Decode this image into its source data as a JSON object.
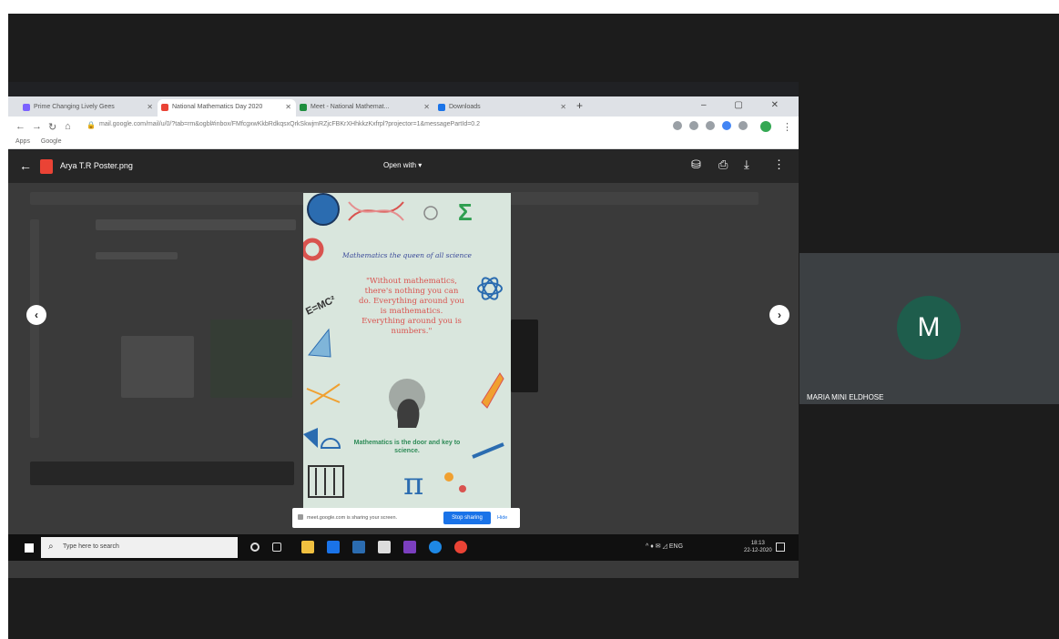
{
  "browser": {
    "tabs": [
      {
        "label": "Prime Changing Lively Gees",
        "color": "#7b61ff"
      },
      {
        "label": "National Mathematics Day 2020",
        "color": "#ea4335"
      },
      {
        "label": "Meet - National Mathemat...",
        "color": "#1e8e3e"
      },
      {
        "label": "Downloads",
        "color": "#1a73e8"
      }
    ],
    "url": "mail.google.com/mail/u/0/?tab=rm&ogbl#inbox/FMfcgxwKkbRdkqsxQrkSkwjmRZjcFBKrXHhkkzKxfrpl?projector=1&messagePartId=0.2",
    "bookmarks": [
      "Apps",
      "Google"
    ]
  },
  "viewer": {
    "file_name": "Arya T.R Poster.png",
    "open_with": "Open with ▾"
  },
  "poster": {
    "heading": "Mathematics the queen of all science",
    "quote": "\"Without mathematics, there's nothing you can do. Everything around you is mathematics. Everything around you is numbers.\"",
    "formula": "E=MC²",
    "pi": "π",
    "sigma": "Σ",
    "footer": "Mathematics is the door and key to science."
  },
  "sharebar": {
    "text": "meet.google.com is sharing your screen.",
    "stop": "Stop sharing",
    "hide": "Hide"
  },
  "taskbar": {
    "search_placeholder": "Type here to search",
    "tray": "^ ♦ ✉ ◿ ENG",
    "time": "18:13",
    "date": "22-12-2020"
  },
  "participant": {
    "initial": "M",
    "name": "MARIA MINI ELDHOSE",
    "avatar_color": "#1e5d4c"
  }
}
